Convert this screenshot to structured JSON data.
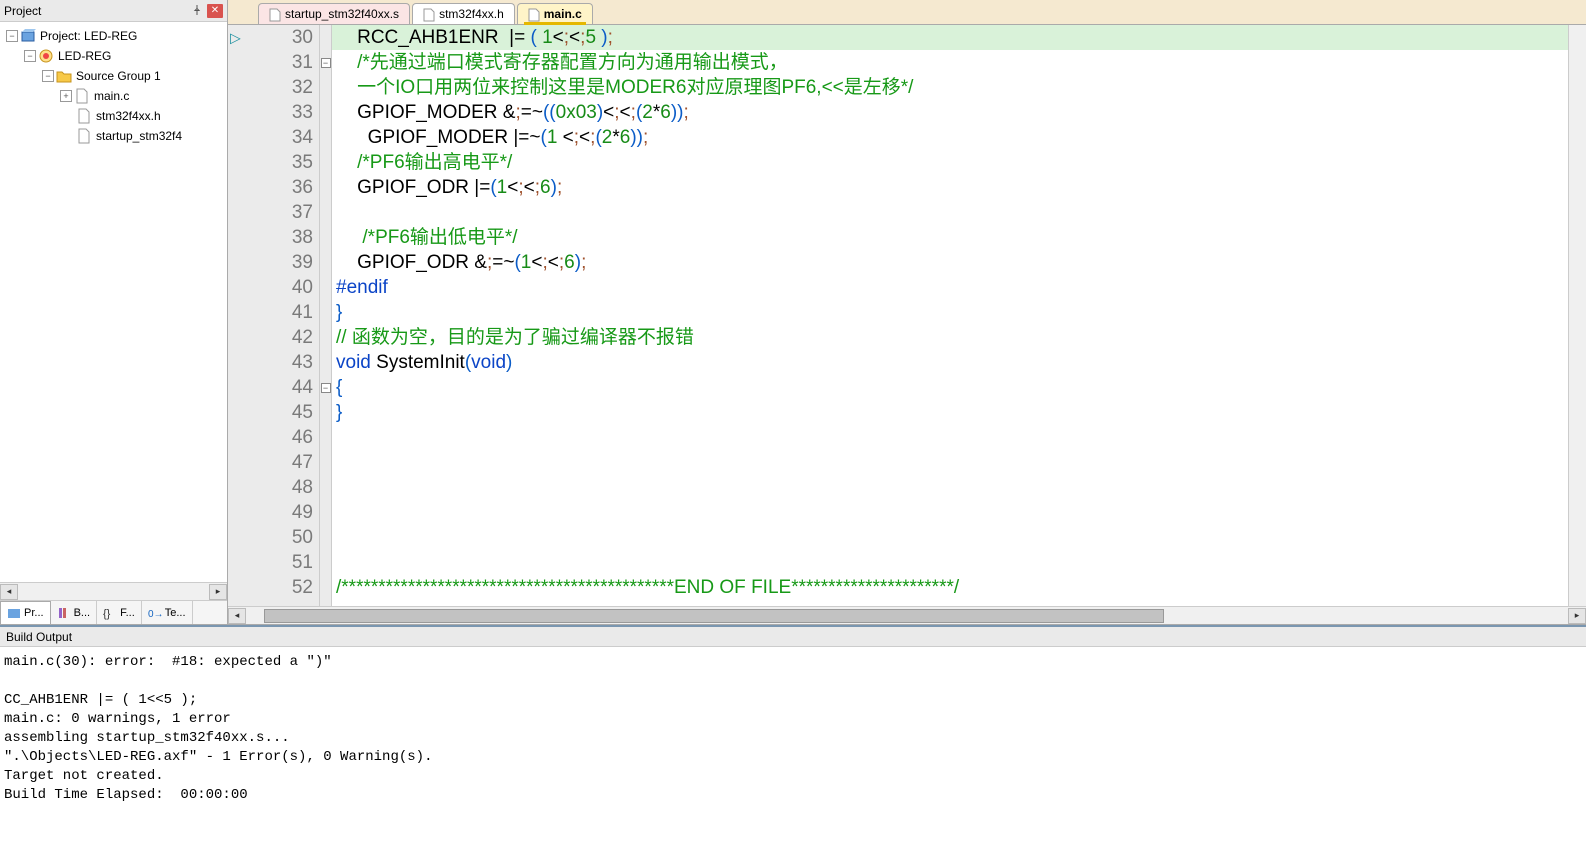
{
  "project_panel": {
    "title": "Project",
    "tree": {
      "root": "Project: LED-REG",
      "target": "LED-REG",
      "group": "Source Group 1",
      "files": [
        "main.c",
        "stm32f4xx.h",
        "startup_stm32f4"
      ]
    },
    "tabs": [
      {
        "label": "Pr...",
        "icon": "project"
      },
      {
        "label": "B...",
        "icon": "books"
      },
      {
        "label": "F...",
        "icon": "func"
      },
      {
        "label": "Te...",
        "icon": "template"
      }
    ]
  },
  "editor": {
    "tabs": [
      {
        "label": "startup_stm32f40xx.s",
        "state": "modified"
      },
      {
        "label": "stm32f4xx.h",
        "state": "normal"
      },
      {
        "label": "main.c",
        "state": "active"
      }
    ],
    "first_line": 30,
    "last_line": 52,
    "lines": {
      "30": "    RCC_AHB1ENR  |= ( 1<<5 );",
      "31": "    /*先通过端口模式寄存器配置方向为通用输出模式，",
      "32": "    一个IO口用两位来控制这里是MODER6对应原理图PF6,<<是左移*/",
      "33": "    GPIOF_MODER &=~((0x03)<<(2*6));",
      "34": "      GPIOF_MODER |=~(1 <<(2*6));",
      "35": "    /*PF6输出高电平*/",
      "36": "    GPIOF_ODR |=(1<<6);",
      "37": "",
      "38": "     /*PF6输出低电平*/",
      "39": "    GPIOF_ODR &=~(1<<6);",
      "40": "#endif",
      "41": "}",
      "42": "// 函数为空，目的是为了骗过编译器不报错",
      "43": "void SystemInit(void)",
      "44": "{",
      "45": "}",
      "46": "",
      "47": "",
      "48": "",
      "49": "",
      "50": "",
      "51": "",
      "52": "/*********************************************END OF FILE**********************/"
    }
  },
  "build_output": {
    "title": "Build Output",
    "lines": [
      "main.c(30): error:  #18: expected a \")\"",
      "",
      "CC_AHB1ENR |= ( 1<<5 );",
      "main.c: 0 warnings, 1 error",
      "assembling startup_stm32f40xx.s...",
      "\".\\Objects\\LED-REG.axf\" - 1 Error(s), 0 Warning(s).",
      "Target not created.",
      "Build Time Elapsed:  00:00:00"
    ]
  }
}
